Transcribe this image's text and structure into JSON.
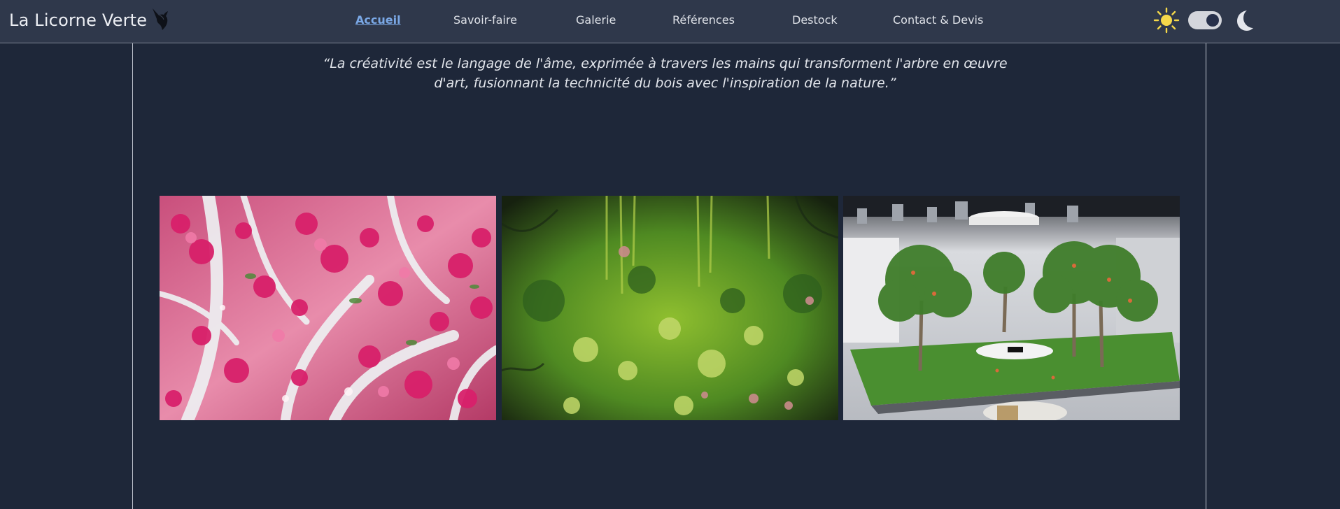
{
  "brand": {
    "name": "La Licorne Verte",
    "logo_icon": "unicorn-icon"
  },
  "nav": {
    "items": [
      {
        "label": "Accueil",
        "active": true
      },
      {
        "label": "Savoir-faire",
        "active": false
      },
      {
        "label": "Galerie",
        "active": false
      },
      {
        "label": "Références",
        "active": false
      },
      {
        "label": "Destock",
        "active": false
      },
      {
        "label": "Contact & Devis",
        "active": false
      }
    ]
  },
  "theme": {
    "light_icon": "sun-icon",
    "dark_icon": "moon-icon",
    "mode": "dark"
  },
  "quote": {
    "text": "“La créativité est le langage de l'âme, exprimée à travers les mains qui transforment l'arbre en œuvre d'art, fusionnant la technicité du bois avec l'inspiration de la nature.”"
  },
  "gallery": {
    "images": [
      {
        "subject": "pink-blossom-tree-photo"
      },
      {
        "subject": "green-moss-wall-photo"
      },
      {
        "subject": "tree-installation-stage-photo"
      }
    ]
  },
  "colors": {
    "background": "#1e2739",
    "navbar": "#2f384b",
    "active_link": "#7aa8e6",
    "text": "#e6e8ee"
  }
}
